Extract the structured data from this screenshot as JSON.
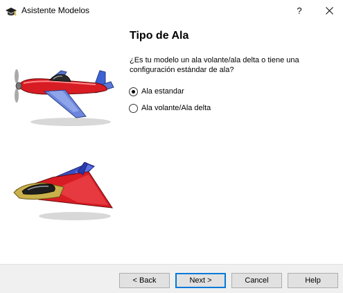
{
  "window": {
    "title": "Asistente Modelos",
    "help_label": "?"
  },
  "page": {
    "title": "Tipo de Ala",
    "question": "¿Es tu modelo un ala volante/ala delta o tiene una configuración estándar de ala?"
  },
  "options": [
    {
      "label": "Ala estandar",
      "selected": true
    },
    {
      "label": "Ala volante/Ala delta",
      "selected": false
    }
  ],
  "buttons": {
    "back": "< Back",
    "next": "Next >",
    "cancel": "Cancel",
    "help": "Help"
  },
  "icons": {
    "app": "graduation-cap-icon",
    "close": "close-icon"
  },
  "colors": {
    "accent": "#0078d7",
    "footer_bg": "#f0f0f0",
    "button_bg": "#e1e1e1",
    "plane_red": "#d81c24",
    "plane_blue": "#3a5fd0"
  }
}
